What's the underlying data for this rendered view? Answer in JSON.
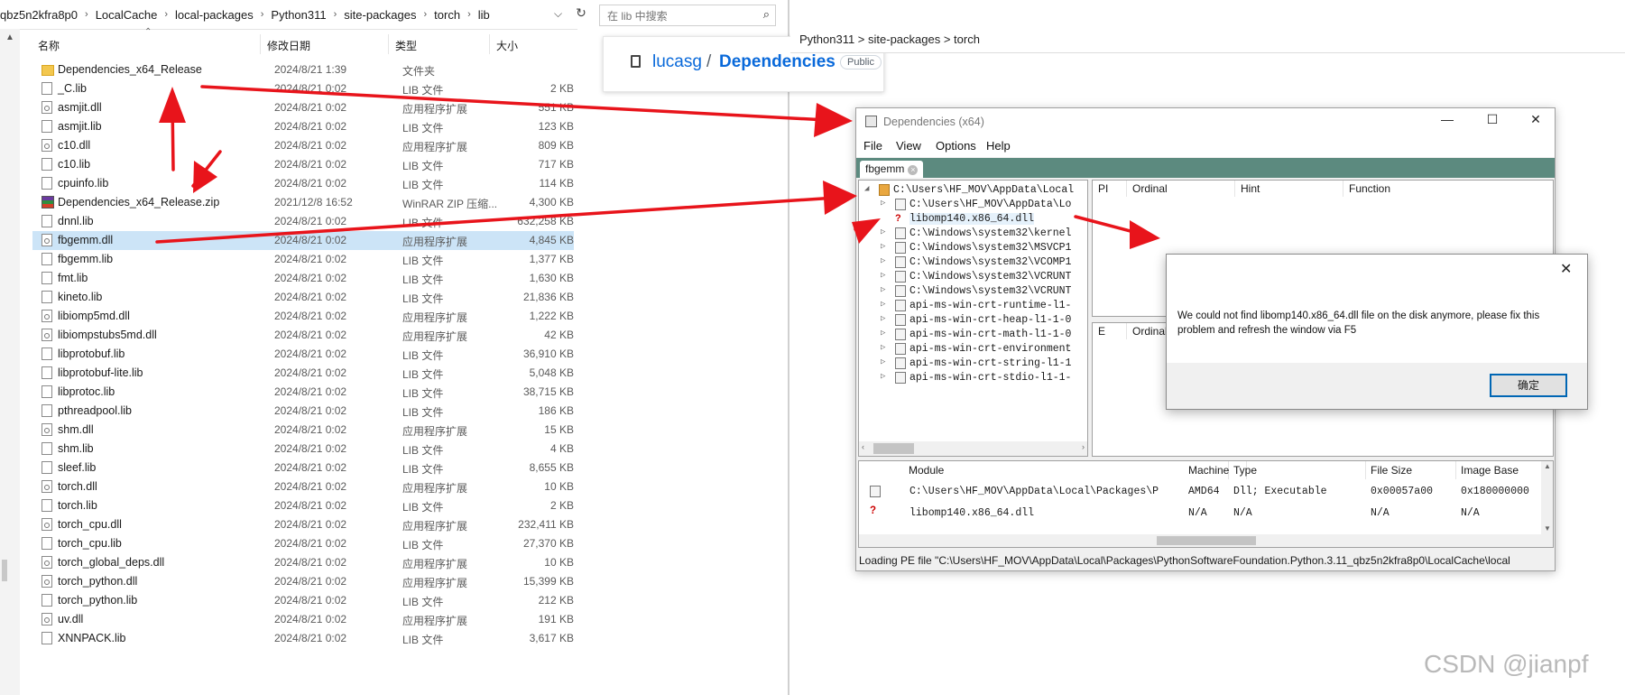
{
  "explorer": {
    "breadcrumbs": [
      "qbz5n2kfra8p0",
      "LocalCache",
      "local-packages",
      "Python311",
      "site-packages",
      "torch",
      "lib"
    ],
    "search_placeholder": "在 lib 中搜索",
    "columns": {
      "name": "名称",
      "date": "修改日期",
      "type": "类型",
      "size": "大小"
    },
    "files": [
      {
        "name": "Dependencies_x64_Release",
        "date": "2024/8/21 1:39",
        "type": "文件夹",
        "size": "",
        "icon": "folder"
      },
      {
        "name": "_C.lib",
        "date": "2024/8/21 0:02",
        "type": "LIB 文件",
        "size": "2 KB",
        "icon": "lib"
      },
      {
        "name": "asmjit.dll",
        "date": "2024/8/21 0:02",
        "type": "应用程序扩展",
        "size": "551 KB",
        "icon": "dll"
      },
      {
        "name": "asmjit.lib",
        "date": "2024/8/21 0:02",
        "type": "LIB 文件",
        "size": "123 KB",
        "icon": "lib"
      },
      {
        "name": "c10.dll",
        "date": "2024/8/21 0:02",
        "type": "应用程序扩展",
        "size": "809 KB",
        "icon": "dll"
      },
      {
        "name": "c10.lib",
        "date": "2024/8/21 0:02",
        "type": "LIB 文件",
        "size": "717 KB",
        "icon": "lib"
      },
      {
        "name": "cpuinfo.lib",
        "date": "2024/8/21 0:02",
        "type": "LIB 文件",
        "size": "114 KB",
        "icon": "lib"
      },
      {
        "name": "Dependencies_x64_Release.zip",
        "date": "2021/12/8 16:52",
        "type": "WinRAR ZIP 压缩...",
        "size": "4,300 KB",
        "icon": "zip"
      },
      {
        "name": "dnnl.lib",
        "date": "2024/8/21 0:02",
        "type": "LIB 文件",
        "size": "632,258 KB",
        "icon": "lib"
      },
      {
        "name": "fbgemm.dll",
        "date": "2024/8/21 0:02",
        "type": "应用程序扩展",
        "size": "4,845 KB",
        "icon": "dll"
      },
      {
        "name": "fbgemm.lib",
        "date": "2024/8/21 0:02",
        "type": "LIB 文件",
        "size": "1,377 KB",
        "icon": "lib"
      },
      {
        "name": "fmt.lib",
        "date": "2024/8/21 0:02",
        "type": "LIB 文件",
        "size": "1,630 KB",
        "icon": "lib"
      },
      {
        "name": "kineto.lib",
        "date": "2024/8/21 0:02",
        "type": "LIB 文件",
        "size": "21,836 KB",
        "icon": "lib"
      },
      {
        "name": "libiomp5md.dll",
        "date": "2024/8/21 0:02",
        "type": "应用程序扩展",
        "size": "1,222 KB",
        "icon": "dll"
      },
      {
        "name": "libiompstubs5md.dll",
        "date": "2024/8/21 0:02",
        "type": "应用程序扩展",
        "size": "42 KB",
        "icon": "dll"
      },
      {
        "name": "libprotobuf.lib",
        "date": "2024/8/21 0:02",
        "type": "LIB 文件",
        "size": "36,910 KB",
        "icon": "lib"
      },
      {
        "name": "libprotobuf-lite.lib",
        "date": "2024/8/21 0:02",
        "type": "LIB 文件",
        "size": "5,048 KB",
        "icon": "lib"
      },
      {
        "name": "libprotoc.lib",
        "date": "2024/8/21 0:02",
        "type": "LIB 文件",
        "size": "38,715 KB",
        "icon": "lib"
      },
      {
        "name": "pthreadpool.lib",
        "date": "2024/8/21 0:02",
        "type": "LIB 文件",
        "size": "186 KB",
        "icon": "lib"
      },
      {
        "name": "shm.dll",
        "date": "2024/8/21 0:02",
        "type": "应用程序扩展",
        "size": "15 KB",
        "icon": "dll"
      },
      {
        "name": "shm.lib",
        "date": "2024/8/21 0:02",
        "type": "LIB 文件",
        "size": "4 KB",
        "icon": "lib"
      },
      {
        "name": "sleef.lib",
        "date": "2024/8/21 0:02",
        "type": "LIB 文件",
        "size": "8,655 KB",
        "icon": "lib"
      },
      {
        "name": "torch.dll",
        "date": "2024/8/21 0:02",
        "type": "应用程序扩展",
        "size": "10 KB",
        "icon": "dll"
      },
      {
        "name": "torch.lib",
        "date": "2024/8/21 0:02",
        "type": "LIB 文件",
        "size": "2 KB",
        "icon": "lib"
      },
      {
        "name": "torch_cpu.dll",
        "date": "2024/8/21 0:02",
        "type": "应用程序扩展",
        "size": "232,411 KB",
        "icon": "dll"
      },
      {
        "name": "torch_cpu.lib",
        "date": "2024/8/21 0:02",
        "type": "LIB 文件",
        "size": "27,370 KB",
        "icon": "lib"
      },
      {
        "name": "torch_global_deps.dll",
        "date": "2024/8/21 0:02",
        "type": "应用程序扩展",
        "size": "10 KB",
        "icon": "dll"
      },
      {
        "name": "torch_python.dll",
        "date": "2024/8/21 0:02",
        "type": "应用程序扩展",
        "size": "15,399 KB",
        "icon": "dll"
      },
      {
        "name": "torch_python.lib",
        "date": "2024/8/21 0:02",
        "type": "LIB 文件",
        "size": "212 KB",
        "icon": "lib"
      },
      {
        "name": "uv.dll",
        "date": "2024/8/21 0:02",
        "type": "应用程序扩展",
        "size": "191 KB",
        "icon": "dll"
      },
      {
        "name": "XNNPACK.lib",
        "date": "2024/8/21 0:02",
        "type": "LIB 文件",
        "size": "3,617 KB",
        "icon": "lib"
      }
    ],
    "selected_index": 9
  },
  "github": {
    "owner": "lucasg",
    "slash": "/",
    "repo": "Dependencies",
    "visibility": "Public"
  },
  "background_window": {
    "path": "Python311  >  site-packages  >  torch"
  },
  "dependencies": {
    "title": "Dependencies (x64)",
    "window_buttons": {
      "minimize": "—",
      "maximize": "☐",
      "close": "✕"
    },
    "menu": [
      "File",
      "View",
      "Options",
      "Help"
    ],
    "tab": "fbgemm",
    "tab_close": "×",
    "tree": [
      {
        "label": "C:\\Users\\HF_MOV\\AppData\\Local",
        "level": 0,
        "kind": "root",
        "expander": "◢"
      },
      {
        "label": "C:\\Users\\HF_MOV\\AppData\\Lo",
        "level": 1,
        "kind": "dll",
        "expander": "▷"
      },
      {
        "label": "libomp140.x86_64.dll",
        "level": 1,
        "kind": "missing",
        "expander": ""
      },
      {
        "label": "C:\\Windows\\system32\\kernel",
        "level": 1,
        "kind": "dll",
        "expander": "▷"
      },
      {
        "label": "C:\\Windows\\system32\\MSVCP1",
        "level": 1,
        "kind": "dll",
        "expander": "▷"
      },
      {
        "label": "C:\\Windows\\system32\\VCOMP1",
        "level": 1,
        "kind": "dll",
        "expander": "▷"
      },
      {
        "label": "C:\\Windows\\system32\\VCRUNT",
        "level": 1,
        "kind": "dll",
        "expander": "▷"
      },
      {
        "label": "C:\\Windows\\system32\\VCRUNT",
        "level": 1,
        "kind": "dll",
        "expander": "▷"
      },
      {
        "label": "api-ms-win-crt-runtime-l1-",
        "level": 1,
        "kind": "dll",
        "expander": "▷"
      },
      {
        "label": "api-ms-win-crt-heap-l1-1-0",
        "level": 1,
        "kind": "dll",
        "expander": "▷"
      },
      {
        "label": "api-ms-win-crt-math-l1-1-0",
        "level": 1,
        "kind": "dll",
        "expander": "▷"
      },
      {
        "label": "api-ms-win-crt-environment",
        "level": 1,
        "kind": "dll",
        "expander": "▷"
      },
      {
        "label": "api-ms-win-crt-string-l1-1",
        "level": 1,
        "kind": "dll",
        "expander": "▷"
      },
      {
        "label": "api-ms-win-crt-stdio-l1-1-",
        "level": 1,
        "kind": "dll",
        "expander": "▷"
      }
    ],
    "imports_columns": [
      "PI",
      "Ordinal",
      "Hint",
      "Function"
    ],
    "exports_columns": [
      "E",
      "Ordinal"
    ],
    "modules_columns": [
      "Module",
      "Machine",
      "Type",
      "File Size",
      "Image Base"
    ],
    "modules": [
      {
        "module": "C:\\Users\\HF_MOV\\AppData\\Local\\Packages\\P",
        "machine": "AMD64",
        "type": "Dll; Executable",
        "file_size": "0x00057a00",
        "image_base": "0x180000000",
        "kind": "dll"
      },
      {
        "module": "libomp140.x86_64.dll",
        "machine": "N/A",
        "type": "N/A",
        "file_size": "N/A",
        "image_base": "N/A",
        "kind": "missing"
      }
    ],
    "status": "Loading PE file \"C:\\Users\\HF_MOV\\AppData\\Local\\Packages\\PythonSoftwareFoundation.Python.3.11_qbz5n2kfra8p0\\LocalCache\\local"
  },
  "dialog": {
    "message": "We could not find libomp140.x86_64.dll file on the disk anymore, please fix this problem and refresh the window via F5",
    "ok_label": "确定",
    "close": "✕"
  },
  "watermark": "CSDN @jianpf",
  "colors": {
    "arrow": "#e8141b",
    "accent_tab": "#5c8a7f",
    "link": "#0969da",
    "selection": "#cce4f7"
  }
}
